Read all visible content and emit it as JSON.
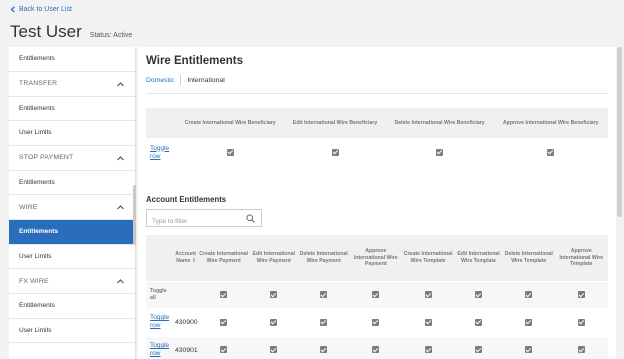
{
  "back_link": "Back to User List",
  "user": {
    "name": "Test User",
    "status": "Status: Active"
  },
  "sidebar": {
    "items": [
      {
        "label": "Entitlements",
        "type": "item"
      },
      {
        "label": "TRANSFER",
        "type": "head"
      },
      {
        "label": "Entitlements",
        "type": "item"
      },
      {
        "label": "User Limits",
        "type": "item"
      },
      {
        "label": "STOP PAYMENT",
        "type": "head"
      },
      {
        "label": "Entitlements",
        "type": "item"
      },
      {
        "label": "WIRE",
        "type": "head"
      },
      {
        "label": "Entitlements",
        "type": "active"
      },
      {
        "label": "User Limits",
        "type": "item"
      },
      {
        "label": "FX WIRE",
        "type": "head"
      },
      {
        "label": "Entitlements",
        "type": "item"
      },
      {
        "label": "User Limits",
        "type": "item"
      }
    ]
  },
  "main": {
    "title": "Wire Entitlements",
    "tabs": [
      {
        "label": "Domestic",
        "state": "link"
      },
      {
        "label": "International",
        "state": "current"
      }
    ],
    "beneficiary_table": {
      "columns": [
        "Create International Wire Beneficiary",
        "Edit International Wire Beneficiary",
        "Delete International Wire Beneficiary",
        "Approve International Wire Beneficiary"
      ],
      "row": {
        "toggle_label": "Toggle row",
        "checked": [
          true,
          true,
          true,
          true
        ]
      }
    },
    "account_section": {
      "title": "Account Entitlements",
      "filter_placeholder": "Type to filter",
      "account_header": "Account Name",
      "sort_icon": "⇕",
      "columns": [
        "Create International Wire Payment",
        "Edit International Wire Payment",
        "Delete International Wire Payment",
        "Approve International Wire Payment",
        "Create International Wire Template",
        "Edit International Wire Template",
        "Delete International Wire Template",
        "Approve International Wire Template"
      ],
      "toggle_all_label": "Toggle all",
      "rows": [
        {
          "toggle_label": "Toggle row",
          "account": "430900"
        },
        {
          "toggle_label": "Toggle row",
          "account": "430901"
        }
      ]
    }
  },
  "colors": {
    "accent": "#2a6ebb",
    "checkbox": "#7c7c7c",
    "header_bg": "#f0f0f0"
  },
  "icons": {
    "back": "chevron-left-icon",
    "section": "chevron-up-icon",
    "filter": "search-icon",
    "checkbox": "checkmark-icon"
  }
}
